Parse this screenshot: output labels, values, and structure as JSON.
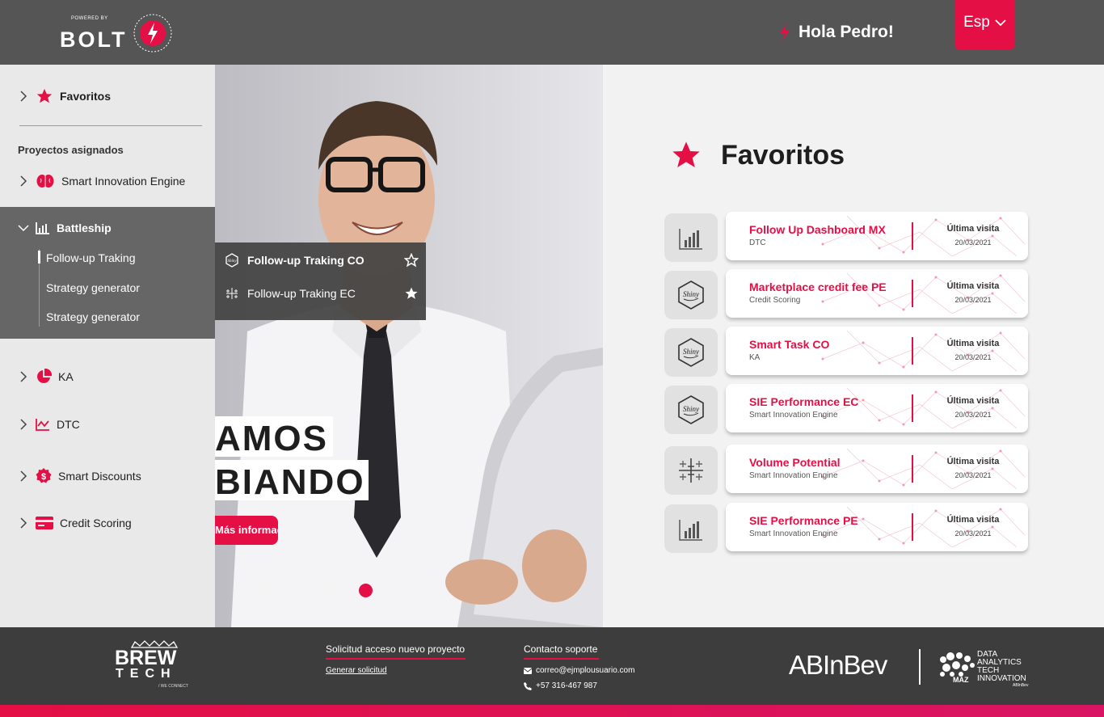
{
  "header": {
    "powered_by": "POWERED BY",
    "logo_text": "BOLT",
    "greeting": "Hola Pedro!",
    "language": "Esp"
  },
  "sidebar": {
    "favorites_label": "Favoritos",
    "assigned_heading": "Proyectos asignados",
    "items": [
      {
        "label": "Smart Innovation Engine",
        "icon": "brain-icon"
      },
      {
        "label": "Battleship",
        "icon": "bar-chart-icon",
        "expanded": true
      },
      {
        "label": "KA",
        "icon": "pie-chart-icon"
      },
      {
        "label": "DTC",
        "icon": "line-chart-icon"
      },
      {
        "label": "Smart Discounts",
        "icon": "discount-icon"
      },
      {
        "label": "Credit Scoring",
        "icon": "credit-card-icon"
      }
    ],
    "battleship_subitems": [
      {
        "label": "Follow-up Traking",
        "active": true
      },
      {
        "label": "Strategy generator"
      },
      {
        "label": "Strategy generator"
      }
    ]
  },
  "popup": {
    "items": [
      {
        "label": "Follow-up Traking CO",
        "icon": "shiny-icon",
        "favorite": false
      },
      {
        "label": "Follow-up Traking EC",
        "icon": "tableau-icon",
        "favorite": true
      }
    ]
  },
  "hero": {
    "line1": "AMOS",
    "line2": "BIANDO",
    "button": "Más información",
    "slides": 4,
    "active_slide": 4
  },
  "favorites": {
    "title": "Favoritos",
    "visit_label": "Última visita",
    "items": [
      {
        "name": "Follow Up Dashboard MX",
        "project": "DTC",
        "date": "20/03/2021",
        "icon": "powerbi-icon"
      },
      {
        "name": "Marketplace credit fee PE",
        "project": "Credit Scoring",
        "date": "20/03/2021",
        "icon": "shiny-icon"
      },
      {
        "name": "Smart Task CO",
        "project": "KA",
        "date": "20/03/2021",
        "icon": "shiny-icon"
      },
      {
        "name": "SIE Performance EC",
        "project": "Smart Innovation Engine",
        "date": "20/03/2021",
        "icon": "shiny-icon"
      },
      {
        "name": "Volume Potential",
        "project": "Smart Innovation Engine",
        "date": "20/03/2021",
        "icon": "tableau-icon"
      },
      {
        "name": "SIE Performance PE",
        "project": "Smart Innovation Engine",
        "date": "20/03/2021",
        "icon": "powerbi-icon"
      }
    ]
  },
  "footer": {
    "brew_main": "BREW",
    "brew_tech": "TECH",
    "brew_tag": "/ WE CONNECT",
    "access_title": "Solicitud acceso nuevo proyecto",
    "access_link": "Generar solicitud",
    "support_title": "Contacto soporte",
    "email": "correo@ejmplousuario.com",
    "phone": "+57 316-467 987",
    "abinbev": "ABInBev",
    "maz_text": [
      "DATA",
      "ANALYTICS",
      "TECH",
      "INNOVATION"
    ],
    "maz_label": "MAZ",
    "maz_sub": "ABInBev"
  },
  "colors": {
    "accent": "#e30f45",
    "header_bg": "#555555",
    "sidebar_bg": "#e9e9e9",
    "sidebar_expanded_bg": "#666666",
    "footer_bg": "#3d3d3d"
  }
}
